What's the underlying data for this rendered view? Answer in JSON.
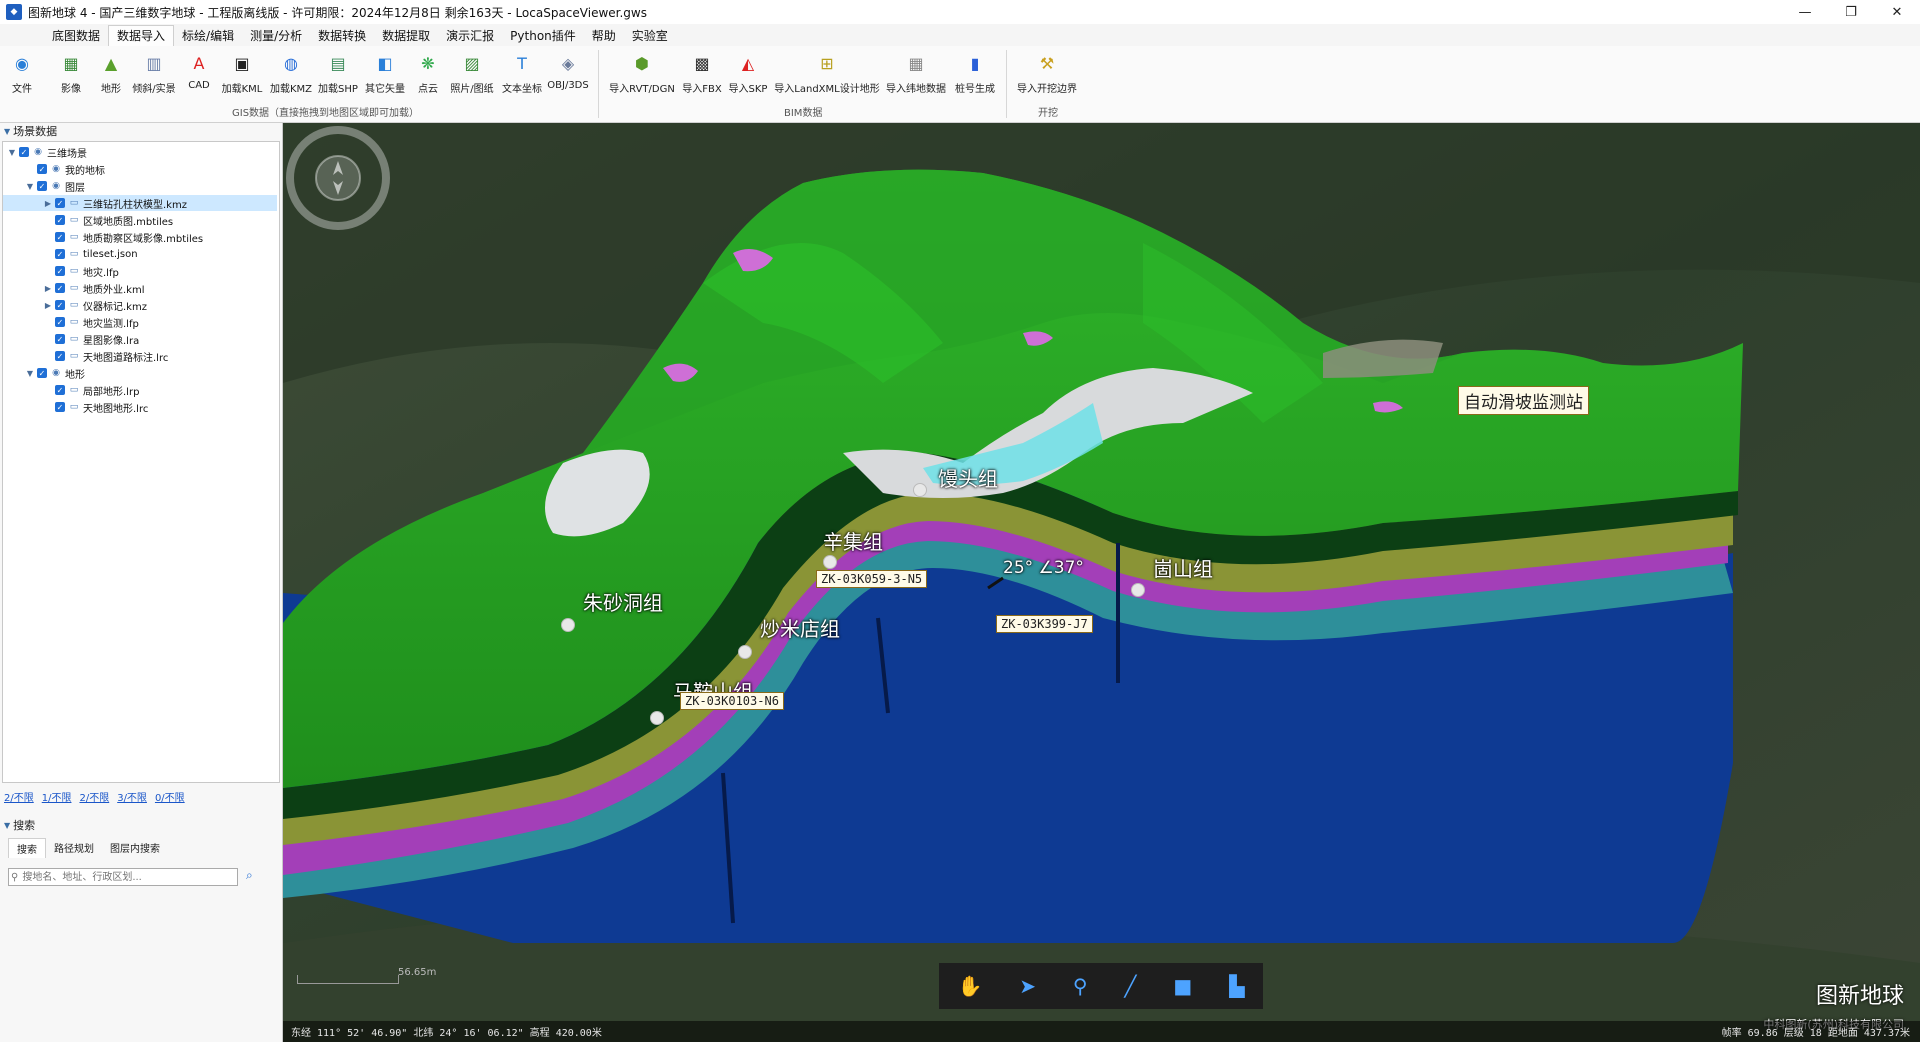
{
  "window": {
    "title": "图新地球 4 - 国产三维数字地球 - 工程版离线版 - 许可期限：2024年12月8日 剩余163天 - LocaSpaceViewer.gws",
    "controls": [
      "—",
      "❐",
      "✕"
    ]
  },
  "menu": [
    "底图数据",
    "数据导入",
    "标绘/编辑",
    "测量/分析",
    "数据转换",
    "数据提取",
    "演示汇报",
    "Python插件",
    "帮助",
    "实验室"
  ],
  "ribbon": {
    "file": "文件",
    "gis_buttons": [
      "影像",
      "地形",
      "倾斜/实景",
      "CAD",
      "加载KML",
      "加载KMZ",
      "加载SHP",
      "其它矢量",
      "点云",
      "照片/图纸",
      "文本坐标",
      "OBJ/3DS"
    ],
    "gis_group": "GIS数据（直接拖拽到地图区域即可加载）",
    "bim_buttons": [
      "导入RVT/DGN",
      "导入FBX",
      "导入SKP",
      "导入LandXML设计地形",
      "导入纬地数据",
      "桩号生成"
    ],
    "bim_group": "BIM数据",
    "excavation_buttons": [
      "导入开挖边界"
    ],
    "excavation_group": "开挖"
  },
  "scene_panel": {
    "header": "场景数据",
    "tree": [
      {
        "label": "三维场景",
        "level": 0,
        "expand": "open"
      },
      {
        "label": "我的地标",
        "level": 1,
        "expand": ""
      },
      {
        "label": "图层",
        "level": 1,
        "expand": "open"
      },
      {
        "label": "三维钻孔柱状模型.kmz",
        "level": 2,
        "expand": "closed",
        "selected": true
      },
      {
        "label": "区域地质图.mbtiles",
        "level": 2,
        "expand": ""
      },
      {
        "label": "地质勘察区域影像.mbtiles",
        "level": 2,
        "expand": ""
      },
      {
        "label": "tileset.json",
        "level": 2,
        "expand": ""
      },
      {
        "label": "地灾.lfp",
        "level": 2,
        "expand": ""
      },
      {
        "label": "地质外业.kml",
        "level": 2,
        "expand": "closed"
      },
      {
        "label": "仪器标记.kmz",
        "level": 2,
        "expand": "closed"
      },
      {
        "label": "地灾监测.lfp",
        "level": 2,
        "expand": ""
      },
      {
        "label": "星图影像.lra",
        "level": 2,
        "expand": ""
      },
      {
        "label": "天地图道路标注.lrc",
        "level": 2,
        "expand": ""
      },
      {
        "label": "地形",
        "level": 1,
        "expand": "open"
      },
      {
        "label": "局部地形.lrp",
        "level": 2,
        "expand": ""
      },
      {
        "label": "天地图地形.lrc",
        "level": 2,
        "expand": ""
      }
    ],
    "stats": [
      "2/不限",
      "1/不限",
      "2/不限",
      "3/不限",
      "0/不限"
    ]
  },
  "search": {
    "header": "搜索",
    "tabs": [
      "搜索",
      "路径规划",
      "图层内搜索"
    ],
    "placeholder": "搜地名、地址、行政区划..."
  },
  "map": {
    "labels": [
      "馒头组",
      "辛集组",
      "崮山组",
      "朱砂洞组",
      "炒米店组",
      "马鞍山组"
    ],
    "boreholes": [
      "ZK-03K059-3-N5",
      "ZK-03K399-J7",
      "ZK-03K0103-N6"
    ],
    "station": "自动滑坡监测站",
    "angle": "25° ∠37°",
    "scale": "56.65m",
    "brand": "图新地球",
    "company": "中科图新(苏州)科技有限公司",
    "status_left": "东经 111° 52' 46.90\"  北纬 24° 16' 06.12\"  高程 420.00米",
    "status_right": "帧率 69.86  层级 18  距地面 437.37米"
  }
}
